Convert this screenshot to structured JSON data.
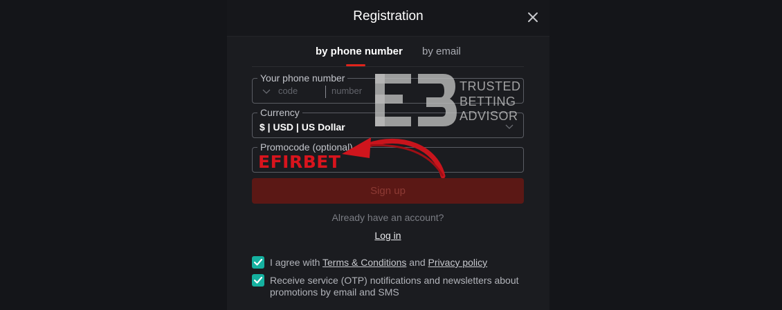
{
  "modal": {
    "title": "Registration"
  },
  "tabs": [
    {
      "label": "by phone number",
      "active": true
    },
    {
      "label": "by email",
      "active": false
    }
  ],
  "phone": {
    "label": "Your phone number",
    "code_placeholder": "code",
    "number_placeholder": "number"
  },
  "currency": {
    "label": "Currency",
    "value": "$ | USD | US Dollar"
  },
  "promocode": {
    "label": "Promocode (optional)",
    "value": "EFIRBET"
  },
  "signup": {
    "label": "Sign up"
  },
  "login": {
    "prompt": "Already have an account?",
    "link": "Log in"
  },
  "consents": {
    "terms": {
      "prefix": "I agree with",
      "terms_link": "Terms & Conditions",
      "and": "and",
      "privacy_link": "Privacy policy",
      "checked": true
    },
    "otp": {
      "text": "Receive service (OTP) notifications and newsletters about promotions by email and SMS",
      "checked": true
    }
  },
  "watermark": {
    "line1": "TRUSTED",
    "line2": "BETTING",
    "line3": "ADVISOR"
  },
  "colors": {
    "accent": "#e0241b",
    "checkbox": "#15b1a0",
    "signup_bg": "#5b1815",
    "promo_text": "#d8141d"
  }
}
